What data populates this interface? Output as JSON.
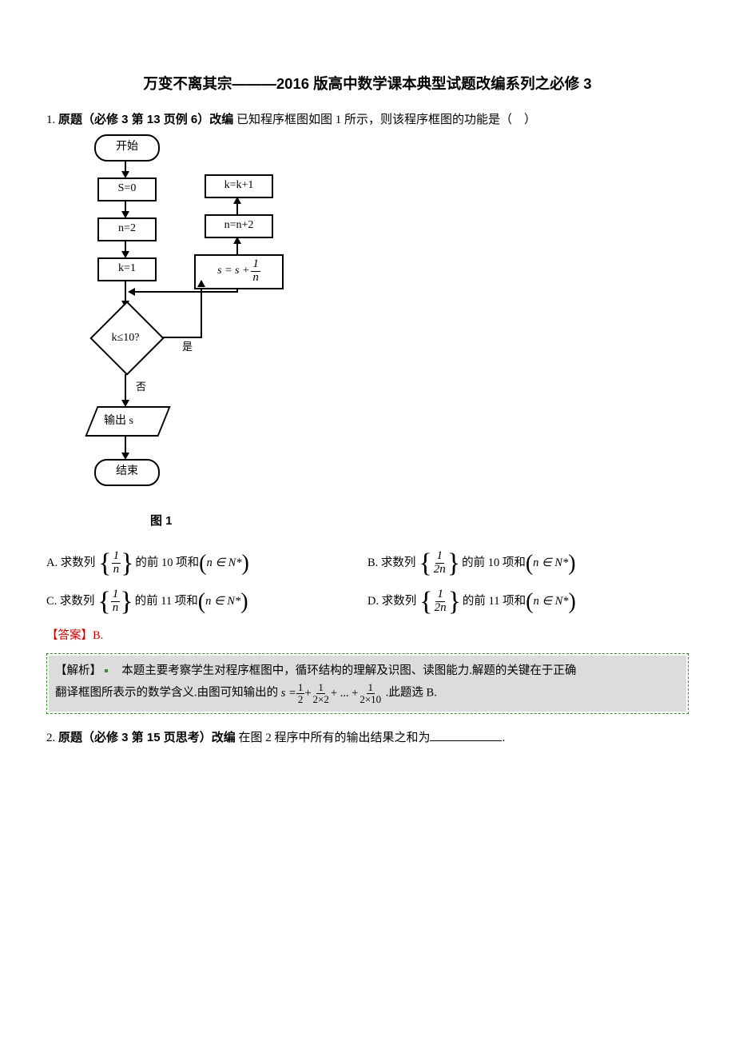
{
  "title": "万变不离其宗———2016 版高中数学课本典型试题改编系列之必修 3",
  "q1": {
    "prefix_num": "1.",
    "bold": "原题（必修 3 第 13 页例 6）改编",
    "rest": "已知程序框图如图 1 所示，则该程序框图的功能是（　）"
  },
  "flowchart": {
    "start": "开始",
    "s0": "S=0",
    "n2": "n=2",
    "k1": "k=1",
    "cond": "k≤10?",
    "no": "否",
    "yes": "是",
    "output": "输出 s",
    "end": "结束",
    "right_top": "k=k+1",
    "right_mid": "n=n+2",
    "right_bot_s": "s = s + ",
    "right_bot_frac_num": "1",
    "right_bot_frac_den": "n"
  },
  "fig_caption": "图 1",
  "opts": {
    "A": {
      "pre": "A. 求数列",
      "num": "1",
      "den": "n",
      "mid": "的前 10 项和",
      "set": "n ∈ N*"
    },
    "B": {
      "pre": "B. 求数列",
      "num": "1",
      "den": "2n",
      "mid": "的前 10 项和",
      "set": "n ∈ N*"
    },
    "C": {
      "pre": "C. 求数列",
      "num": "1",
      "den": "n",
      "mid": "的前 11 项和",
      "set": "n ∈ N*"
    },
    "D": {
      "pre": "D. 求数列",
      "num": "1",
      "den": "2n",
      "mid": "的前 11 项和",
      "set": "n ∈ N*"
    }
  },
  "answer": "【答案】B.",
  "analysis": {
    "head": "【解析】",
    "line1": "本题主要考察学生对程序框图中，循环结构的理解及识图、读图能力.解题的关键在于正确",
    "line2a": "翻译框图所表示的数学含义.由图可知输出的 ",
    "eq_s": "s = ",
    "t1n": "1",
    "t1d": "2",
    "plus1": " + ",
    "t2n": "1",
    "t2d": "2×2",
    "plus2": " + ... + ",
    "t3n": "1",
    "t3d": "2×10",
    "line2b": " .此题选 B."
  },
  "q2": {
    "prefix_num": "2.",
    "bold": "原题（必修 3 第 15 页思考）改编",
    "rest_a": "在图 2 程序中所有的输出结果之和为",
    "rest_b": "."
  }
}
